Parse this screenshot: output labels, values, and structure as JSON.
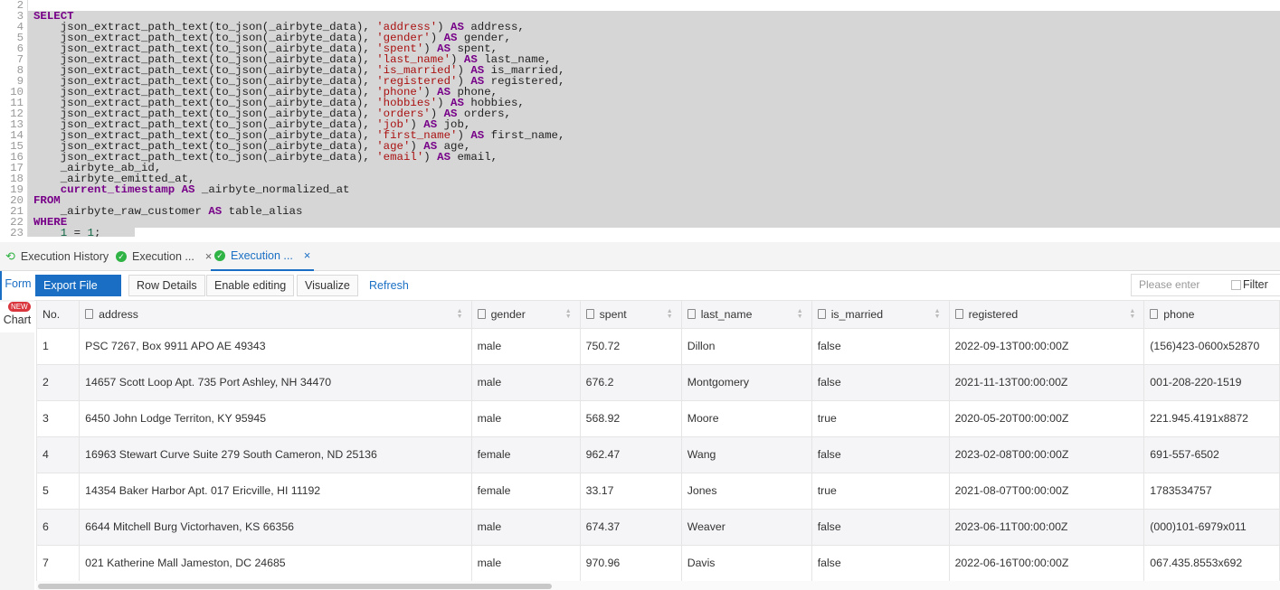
{
  "editor": {
    "first_line": 2,
    "lines": [
      [],
      [
        [
          "SELECT",
          "kw"
        ]
      ],
      [
        [
          "    json_extract_path_text(to_json(_airbyte_data), ",
          ""
        ],
        [
          "'address'",
          "str"
        ],
        [
          ") ",
          ""
        ],
        [
          "AS",
          "kw"
        ],
        [
          " address,",
          ""
        ]
      ],
      [
        [
          "    json_extract_path_text(to_json(_airbyte_data), ",
          ""
        ],
        [
          "'gender'",
          "str"
        ],
        [
          ") ",
          ""
        ],
        [
          "AS",
          "kw"
        ],
        [
          " gender,",
          ""
        ]
      ],
      [
        [
          "    json_extract_path_text(to_json(_airbyte_data), ",
          ""
        ],
        [
          "'spent'",
          "str"
        ],
        [
          ") ",
          ""
        ],
        [
          "AS",
          "kw"
        ],
        [
          " spent,",
          ""
        ]
      ],
      [
        [
          "    json_extract_path_text(to_json(_airbyte_data), ",
          ""
        ],
        [
          "'last_name'",
          "str"
        ],
        [
          ") ",
          ""
        ],
        [
          "AS",
          "kw"
        ],
        [
          " last_name,",
          ""
        ]
      ],
      [
        [
          "    json_extract_path_text(to_json(_airbyte_data), ",
          ""
        ],
        [
          "'is_married'",
          "str"
        ],
        [
          ") ",
          ""
        ],
        [
          "AS",
          "kw"
        ],
        [
          " is_married,",
          ""
        ]
      ],
      [
        [
          "    json_extract_path_text(to_json(_airbyte_data), ",
          ""
        ],
        [
          "'registered'",
          "str"
        ],
        [
          ") ",
          ""
        ],
        [
          "AS",
          "kw"
        ],
        [
          " registered,",
          ""
        ]
      ],
      [
        [
          "    json_extract_path_text(to_json(_airbyte_data), ",
          ""
        ],
        [
          "'phone'",
          "str"
        ],
        [
          ") ",
          ""
        ],
        [
          "AS",
          "kw"
        ],
        [
          " phone,",
          ""
        ]
      ],
      [
        [
          "    json_extract_path_text(to_json(_airbyte_data), ",
          ""
        ],
        [
          "'hobbies'",
          "str"
        ],
        [
          ") ",
          ""
        ],
        [
          "AS",
          "kw"
        ],
        [
          " hobbies,",
          ""
        ]
      ],
      [
        [
          "    json_extract_path_text(to_json(_airbyte_data), ",
          ""
        ],
        [
          "'orders'",
          "str"
        ],
        [
          ") ",
          ""
        ],
        [
          "AS",
          "kw"
        ],
        [
          " orders,",
          ""
        ]
      ],
      [
        [
          "    json_extract_path_text(to_json(_airbyte_data), ",
          ""
        ],
        [
          "'job'",
          "str"
        ],
        [
          ") ",
          ""
        ],
        [
          "AS",
          "kw"
        ],
        [
          " job,",
          ""
        ]
      ],
      [
        [
          "    json_extract_path_text(to_json(_airbyte_data), ",
          ""
        ],
        [
          "'first_name'",
          "str"
        ],
        [
          ") ",
          ""
        ],
        [
          "AS",
          "kw"
        ],
        [
          " first_name,",
          ""
        ]
      ],
      [
        [
          "    json_extract_path_text(to_json(_airbyte_data), ",
          ""
        ],
        [
          "'age'",
          "str"
        ],
        [
          ") ",
          ""
        ],
        [
          "AS",
          "kw"
        ],
        [
          " age,",
          ""
        ]
      ],
      [
        [
          "    json_extract_path_text(to_json(_airbyte_data), ",
          ""
        ],
        [
          "'email'",
          "str"
        ],
        [
          ") ",
          ""
        ],
        [
          "AS",
          "kw"
        ],
        [
          " email,",
          ""
        ]
      ],
      [
        [
          "    _airbyte_ab_id,",
          ""
        ]
      ],
      [
        [
          "    _airbyte_emitted_at,",
          ""
        ]
      ],
      [
        [
          "    ",
          ""
        ],
        [
          "current_timestamp",
          "kw"
        ],
        [
          " ",
          ""
        ],
        [
          "AS",
          "kw"
        ],
        [
          " _airbyte_normalized_at",
          ""
        ]
      ],
      [
        [
          "FROM",
          "kw"
        ]
      ],
      [
        [
          "    _airbyte_raw_customer ",
          ""
        ],
        [
          "AS",
          "kw"
        ],
        [
          " table_alias",
          ""
        ]
      ],
      [
        [
          "WHERE",
          "kw"
        ]
      ],
      [
        [
          "    ",
          ""
        ],
        [
          "1",
          "num"
        ],
        [
          " = ",
          ""
        ],
        [
          "1",
          "num"
        ],
        [
          ";",
          ""
        ]
      ]
    ]
  },
  "tabs": [
    {
      "label": "Execution History",
      "icon": "history-icon"
    },
    {
      "label": "Execution ...",
      "icon": "success-check-icon",
      "close": "×"
    },
    {
      "label": "Execution ...",
      "icon": "success-check-icon",
      "close": "×",
      "active": true
    }
  ],
  "side": {
    "form": "Form",
    "chart": "Chart",
    "new_badge": "NEW"
  },
  "toolbar": {
    "export": "Export File",
    "row_details": "Row Details",
    "enable_editing": "Enable editing",
    "visualize": "Visualize",
    "refresh": "Refresh",
    "search_placeholder": "Please enter",
    "filter": "Filter"
  },
  "colors": {
    "accent": "#1a6fc4",
    "success": "#2fb344",
    "badge": "#d9363e",
    "selection": "#d6d6d6"
  },
  "table": {
    "columns": [
      "No.",
      "address",
      "gender",
      "spent",
      "last_name",
      "is_married",
      "registered",
      "phone"
    ],
    "rows": [
      [
        "1",
        "PSC 7267, Box 9911 APO AE 49343",
        "male",
        "750.72",
        "Dillon",
        "false",
        "2022-09-13T00:00:00Z",
        "(156)423-0600x52870"
      ],
      [
        "2",
        "14657 Scott Loop Apt. 735 Port Ashley, NH 34470",
        "male",
        "676.2",
        "Montgomery",
        "false",
        "2021-11-13T00:00:00Z",
        "001-208-220-1519"
      ],
      [
        "3",
        "6450 John Lodge Territon, KY 95945",
        "male",
        "568.92",
        "Moore",
        "true",
        "2020-05-20T00:00:00Z",
        "221.945.4191x8872"
      ],
      [
        "4",
        "16963 Stewart Curve Suite 279 South Cameron, ND 25136",
        "female",
        "962.47",
        "Wang",
        "false",
        "2023-02-08T00:00:00Z",
        "691-557-6502"
      ],
      [
        "5",
        "14354 Baker Harbor Apt. 017 Ericville, HI 11192",
        "female",
        "33.17",
        "Jones",
        "true",
        "2021-08-07T00:00:00Z",
        "1783534757"
      ],
      [
        "6",
        "6644 Mitchell Burg Victorhaven, KS 66356",
        "male",
        "674.37",
        "Weaver",
        "false",
        "2023-06-11T00:00:00Z",
        "(000)101-6979x011"
      ],
      [
        "7",
        "021 Katherine Mall Jameston, DC 24685",
        "male",
        "970.96",
        "Davis",
        "false",
        "2022-06-16T00:00:00Z",
        "067.435.8553x692"
      ]
    ]
  }
}
